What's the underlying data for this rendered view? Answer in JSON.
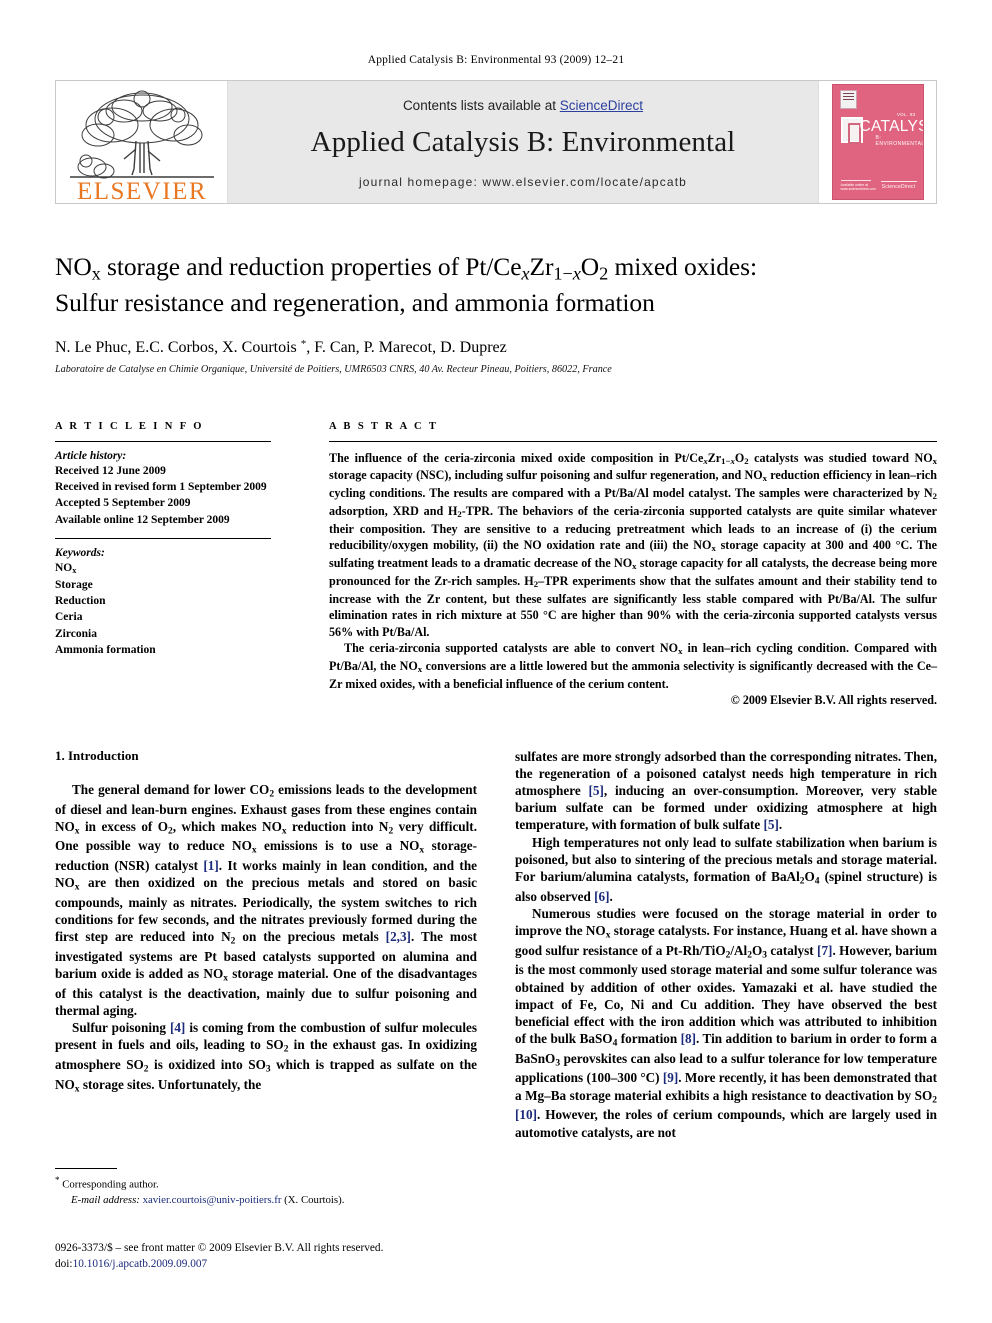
{
  "running_head": "Applied Catalysis B: Environmental 93 (2009) 12–21",
  "masthead": {
    "contents_prefix": "Contents lists available at ",
    "sciencedirect": "ScienceDirect",
    "journal_title": "Applied Catalysis B: Environmental",
    "homepage": "journal homepage: www.elsevier.com/locate/apcatb",
    "publisher_logo_text": "ELSEVIER",
    "cover": {
      "word": "CATALYSIS",
      "subtitle": "B: ENVIRONMENTAL",
      "topright": "VOL. 93",
      "botleft": "Available online at www.sciencedirect.com",
      "botright": "ScienceDirect"
    },
    "colors": {
      "panel_bg": "#e8e8e8",
      "link": "#2b3f9e",
      "elsevier_orange": "#e87722",
      "cover_pink": "#e0647f"
    }
  },
  "title": {
    "line1_pre": "NO",
    "line1_sub": "x",
    "line1_mid": " storage and reduction properties of Pt/Ce",
    "line1_sub2": "x",
    "line1_zr": "Zr",
    "line1_sub3": "1−x",
    "line1_o": "O",
    "line1_sub4": "2",
    "line1_end": " mixed oxides:",
    "line2": "Sulfur resistance and regeneration, and ammonia formation",
    "authors": "N. Le Phuc, E.C. Corbos, X. Courtois *, F. Can, P. Marecot, D. Duprez",
    "affiliation": "Laboratoire de Catalyse en Chimie Organique, Université de Poitiers, UMR6503 CNRS, 40 Av. Recteur Pineau, Poitiers, 86022, France"
  },
  "article_info": {
    "label": "A R T I C L E    I N F O",
    "history_title": "Article history:",
    "history": [
      "Received 12 June 2009",
      "Received in revised form 1 September 2009",
      "Accepted 5 September 2009",
      "Available online 12 September 2009"
    ],
    "keywords_title": "Keywords:",
    "keywords": [
      "NOx",
      "Storage",
      "Reduction",
      "Ceria",
      "Zirconia",
      "Ammonia formation"
    ]
  },
  "abstract": {
    "label": "A B S T R A C T",
    "paragraph1": "The influence of the ceria-zirconia mixed oxide composition in Pt/CexZr1−xO2 catalysts was studied toward NOx storage capacity (NSC), including sulfur poisoning and sulfur regeneration, and NOx reduction efficiency in lean–rich cycling conditions. The results are compared with a Pt/Ba/Al model catalyst. The samples were characterized by N2 adsorption, XRD and H2-TPR. The behaviors of the ceria-zirconia supported catalysts are quite similar whatever their composition. They are sensitive to a reducing pretreatment which leads to an increase of (i) the cerium reducibility/oxygen mobility, (ii) the NO oxidation rate and (iii) the NOx storage capacity at 300 and 400 °C. The sulfating treatment leads to a dramatic decrease of the NOx storage capacity for all catalysts, the decrease being more pronounced for the Zr-rich samples. H2–TPR experiments show that the sulfates amount and their stability tend to increase with the Zr content, but these sulfates are significantly less stable compared with Pt/Ba/Al. The sulfur elimination rates in rich mixture at 550 °C are higher than 90% with the ceria-zirconia supported catalysts versus 56% with Pt/Ba/Al.",
    "paragraph2": "The ceria-zirconia supported catalysts are able to convert NOx in lean–rich cycling condition. Compared with Pt/Ba/Al, the NOx conversions are a little lowered but the ammonia selectivity is significantly decreased with the Ce–Zr mixed oxides, with a beneficial influence of the cerium content.",
    "copyright": "© 2009 Elsevier B.V. All rights reserved."
  },
  "body": {
    "section_heading": "1. Introduction",
    "left_p1": "The general demand for lower CO2 emissions leads to the development of diesel and lean-burn engines. Exhaust gases from these engines contain NOx in excess of O2, which makes NOx reduction into N2 very difficult. One possible way to reduce NOx emissions is to use a NOx storage-reduction (NSR) catalyst [1]. It works mainly in lean condition, and the NOx are then oxidized on the precious metals and stored on basic compounds, mainly as nitrates. Periodically, the system switches to rich conditions for few seconds, and the nitrates previously formed during the first step are reduced into N2 on the precious metals [2,3]. The most investigated systems are Pt based catalysts supported on alumina and barium oxide is added as NOx storage material. One of the disadvantages of this catalyst is the deactivation, mainly due to sulfur poisoning and thermal aging.",
    "left_p2": "Sulfur poisoning [4] is coming from the combustion of sulfur molecules present in fuels and oils, leading to SO2 in the exhaust gas. In oxidizing atmosphere SO2 is oxidized into SO3 which is trapped as sulfate on the NOx storage sites. Unfortunately, the",
    "right_p1": "sulfates are more strongly adsorbed than the corresponding nitrates. Then, the regeneration of a poisoned catalyst needs high temperature in rich atmosphere [5], inducing an over-consumption. Moreover, very stable barium sulfate can be formed under oxidizing atmosphere at high temperature, with formation of bulk sulfate [5].",
    "right_p2": "High temperatures not only lead to sulfate stabilization when barium is poisoned, but also to sintering of the precious metals and storage material. For barium/alumina catalysts, formation of BaAl2O4 (spinel structure) is also observed [6].",
    "right_p3": "Numerous studies were focused on the storage material in order to improve the NOx storage catalysts. For instance, Huang et al. have shown a good sulfur resistance of a Pt-Rh/TiO2/Al2O3 catalyst [7]. However, barium is the most commonly used storage material and some sulfur tolerance was obtained by addition of other oxides. Yamazaki et al. have studied the impact of Fe, Co, Ni and Cu addition. They have observed the best beneficial effect with the iron addition which was attributed to inhibition of the bulk BaSO4 formation [8]. Tin addition to barium in order to form a BaSnO3 perovskites can also lead to a sulfur tolerance for low temperature applications (100–300 °C) [9]. More recently, it has been demonstrated that a Mg–Ba storage material exhibits a high resistance to deactivation by SO2 [10]. However, the roles of cerium compounds, which are largely used in automotive catalysts, are not"
  },
  "footnote": {
    "corresponding": "* Corresponding author.",
    "email_label": "E-mail address:",
    "email": "xavier.courtois@univ-poitiers.fr",
    "email_suffix": " (X. Courtois)."
  },
  "footer": {
    "issn_line": "0926-3373/$ – see front matter © 2009 Elsevier B.V. All rights reserved.",
    "doi_prefix": "doi:",
    "doi": "10.1016/j.apcatb.2009.09.007"
  }
}
